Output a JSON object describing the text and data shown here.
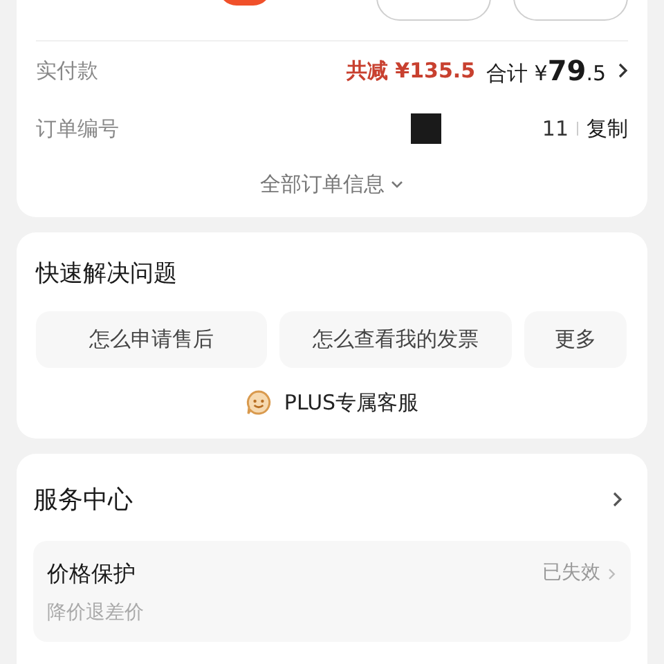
{
  "order_card": {
    "payment": {
      "label": "实付款",
      "discount": "共减 ¥135.5",
      "total_label": "合计",
      "currency": "¥",
      "total_int": "79",
      "total_dec": ".5"
    },
    "order_number": {
      "label": "订单编号",
      "value_tail": "11",
      "copy": "复制"
    },
    "more_info": "全部订单信息"
  },
  "quick_help": {
    "title": "快速解决问题",
    "chips": [
      "怎么申请售后",
      "怎么查看我的发票",
      "更多"
    ],
    "service_link": "PLUS专属客服"
  },
  "service_center": {
    "title": "服务中心",
    "items": [
      {
        "title": "价格保护",
        "status": "已失效",
        "subtitle": "降价退差价"
      }
    ]
  }
}
